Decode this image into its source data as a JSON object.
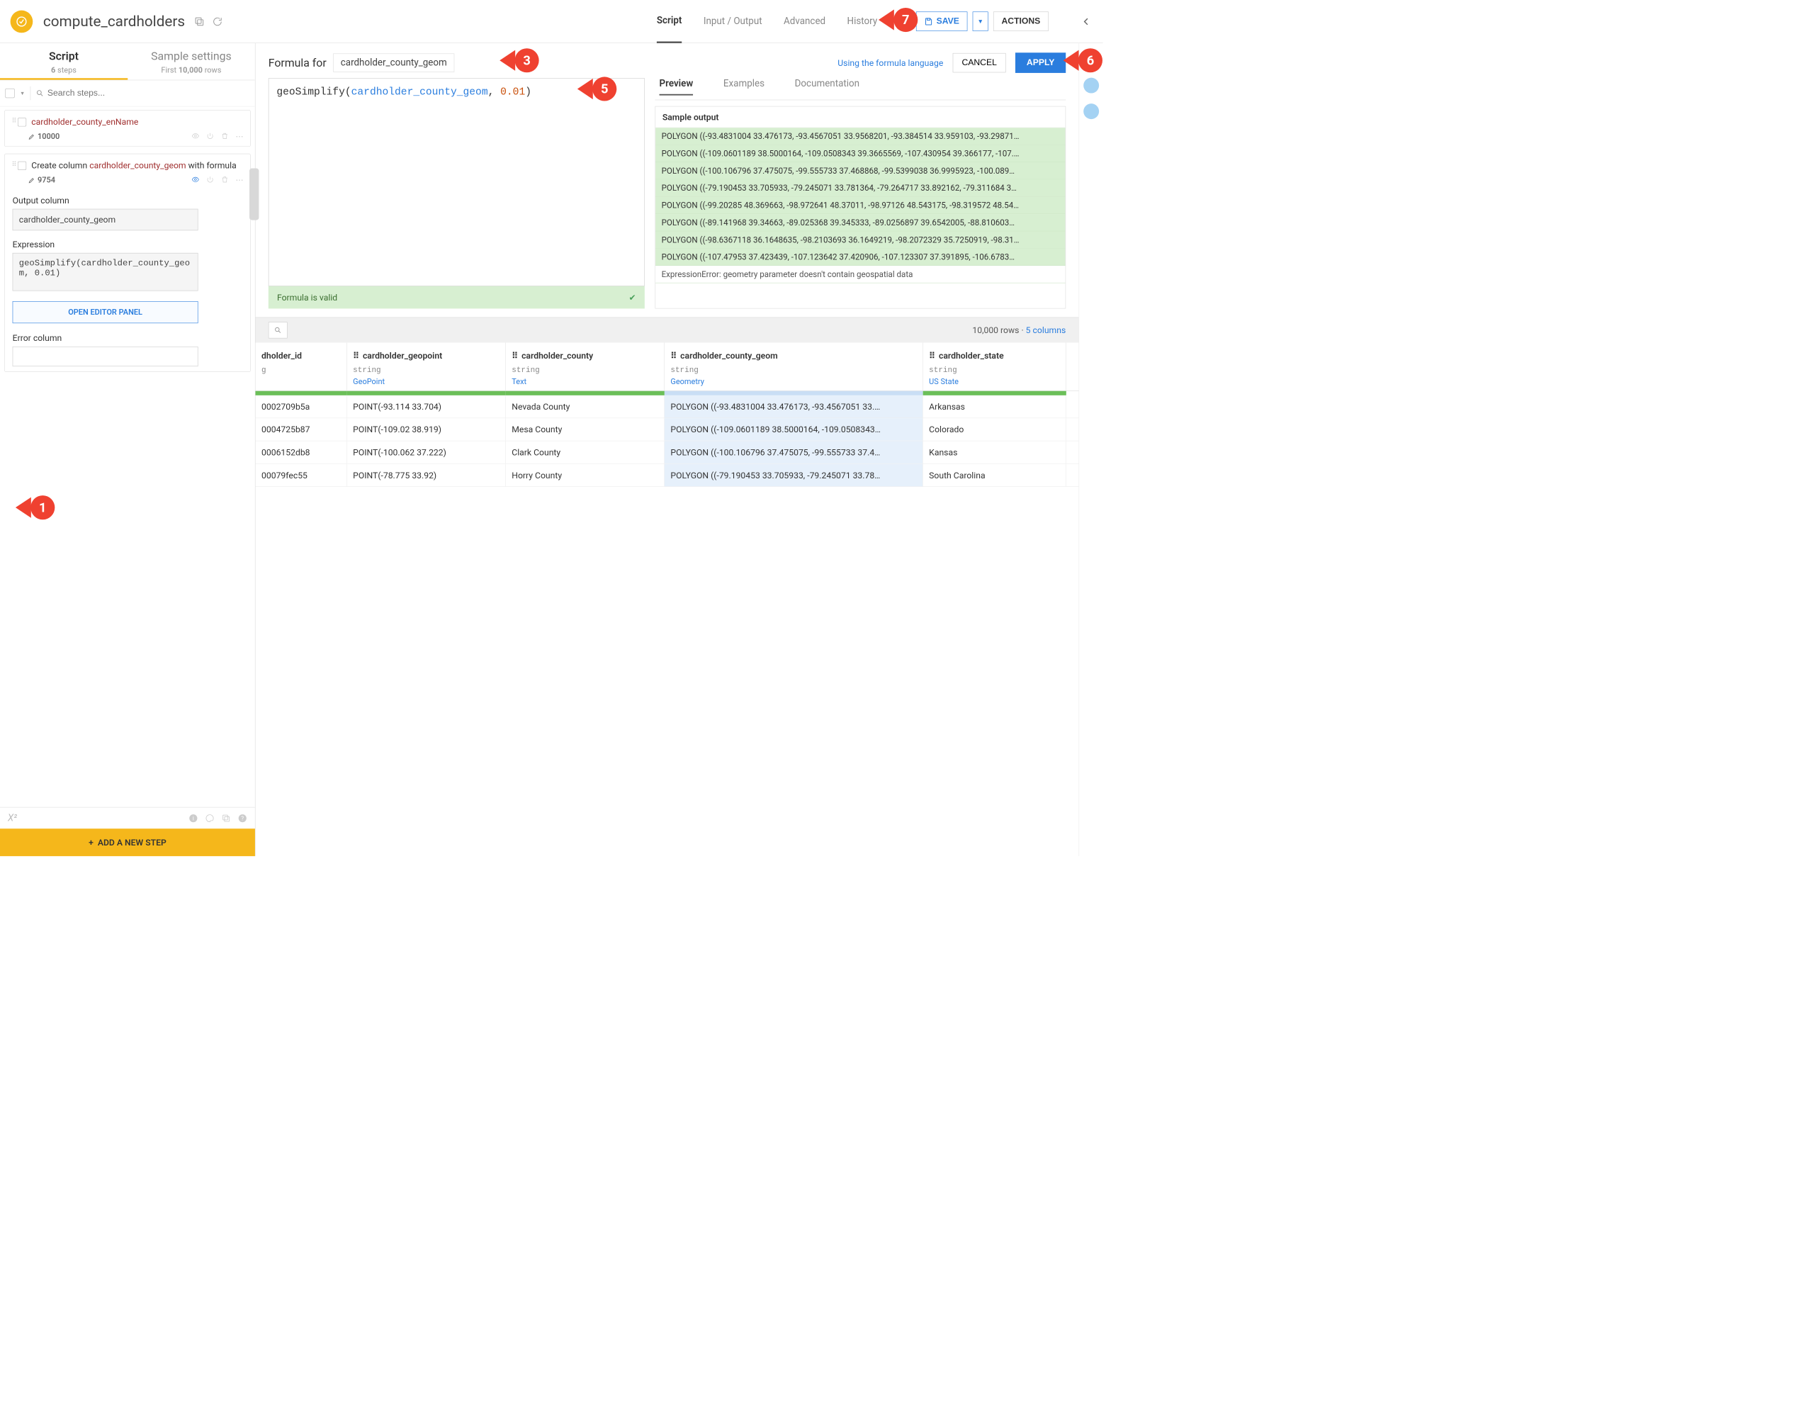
{
  "header": {
    "title": "compute_cardholders",
    "nav": [
      "Script",
      "Input / Output",
      "Advanced",
      "History"
    ],
    "active_nav": 0,
    "save_label": "SAVE",
    "actions_label": "ACTIONS"
  },
  "left_tabs": {
    "script": {
      "title": "Script",
      "sub_prefix": "6",
      "sub": " steps"
    },
    "sample": {
      "title": "Sample settings",
      "sub_prefix": "First ",
      "sub_bold": "10,000",
      "sub_suffix": " rows"
    }
  },
  "left_toolbar": {
    "search_placeholder": "Search steps..."
  },
  "steps": [
    {
      "title_col": "cardholder_county_enName",
      "count": "10000"
    },
    {
      "title_pre": "Create column ",
      "title_col": "cardholder_county_geom",
      "title_post": " with formula",
      "count": "9754",
      "output_label": "Output column",
      "output_value": "cardholder_county_geom",
      "expr_label": "Expression",
      "expr_value": "geoSimplify(cardholder_county_geom, 0.01)",
      "open_panel": "OPEN EDITOR PANEL",
      "error_label": "Error column"
    }
  ],
  "add_step": "ADD A NEW STEP",
  "formula": {
    "label": "Formula for",
    "column": "cardholder_county_geom",
    "link": "Using the formula language",
    "cancel": "CANCEL",
    "apply": "APPLY",
    "code_fn": "geoSimplify",
    "code_col": "cardholder_county_geom",
    "code_num": "0.01",
    "valid": "Formula is valid"
  },
  "preview": {
    "tabs": [
      "Preview",
      "Examples",
      "Documentation"
    ],
    "title": "Sample output",
    "rows": [
      "POLYGON ((-93.4831004 33.476173, -93.4567051 33.9568201, -93.384514 33.959103, -93.29871…",
      "POLYGON ((-109.0601189 38.5000164, -109.0508343 39.3665569, -107.430954 39.366177, -107.…",
      "POLYGON ((-100.106796 37.475075, -99.555733 37.468868, -99.5399038 36.9995923, -100.089…",
      "POLYGON ((-79.190453 33.705933, -79.245071 33.781364, -79.264717 33.892162, -79.311684 3…",
      "POLYGON ((-99.20285 48.369663, -98.972641 48.37011, -98.97126 48.543175, -98.319572 48.54…",
      "POLYGON ((-89.141968 39.34663, -89.025368 39.345333, -89.0256897 39.6542005, -88.810603…",
      "POLYGON ((-98.6367118 36.1648635, -98.2103693 36.1649219, -98.2072329 35.7250919, -98.31…",
      "POLYGON ((-107.47953 37.423439, -107.123642 37.420906, -107.123307 37.391895, -106.6783…"
    ],
    "error": "ExpressionError: geometry parameter doesn't contain geospatial data"
  },
  "grid": {
    "rows_label": "10,000 rows",
    "cols_label": "5 columns",
    "columns": [
      {
        "name": "dholder_id",
        "type": "g",
        "semantic": ""
      },
      {
        "name": "cardholder_geopoint",
        "type": "string",
        "semantic": "GeoPoint"
      },
      {
        "name": "cardholder_county",
        "type": "string",
        "semantic": "Text"
      },
      {
        "name": "cardholder_county_geom",
        "type": "string",
        "semantic": "Geometry"
      },
      {
        "name": "cardholder_state",
        "type": "string",
        "semantic": "US State"
      }
    ],
    "data": [
      [
        "0002709b5a",
        "POINT(-93.114 33.704)",
        "Nevada County",
        "POLYGON ((-93.4831004 33.476173, -93.4567051 33.…",
        "Arkansas"
      ],
      [
        "0004725b87",
        "POINT(-109.02 38.919)",
        "Mesa County",
        "POLYGON ((-109.0601189 38.5000164, -109.0508343…",
        "Colorado"
      ],
      [
        "0006152db8",
        "POINT(-100.062 37.222)",
        "Clark County",
        "POLYGON ((-100.106796 37.475075, -99.555733 37.4…",
        "Kansas"
      ],
      [
        "00079fec55",
        "POINT(-78.775 33.92)",
        "Horry County",
        "POLYGON ((-79.190453 33.705933, -79.245071 33.78…",
        "South Carolina"
      ]
    ]
  },
  "callouts": {
    "c1": "1",
    "c3": "3",
    "c5": "5",
    "c6": "6",
    "c7": "7"
  }
}
